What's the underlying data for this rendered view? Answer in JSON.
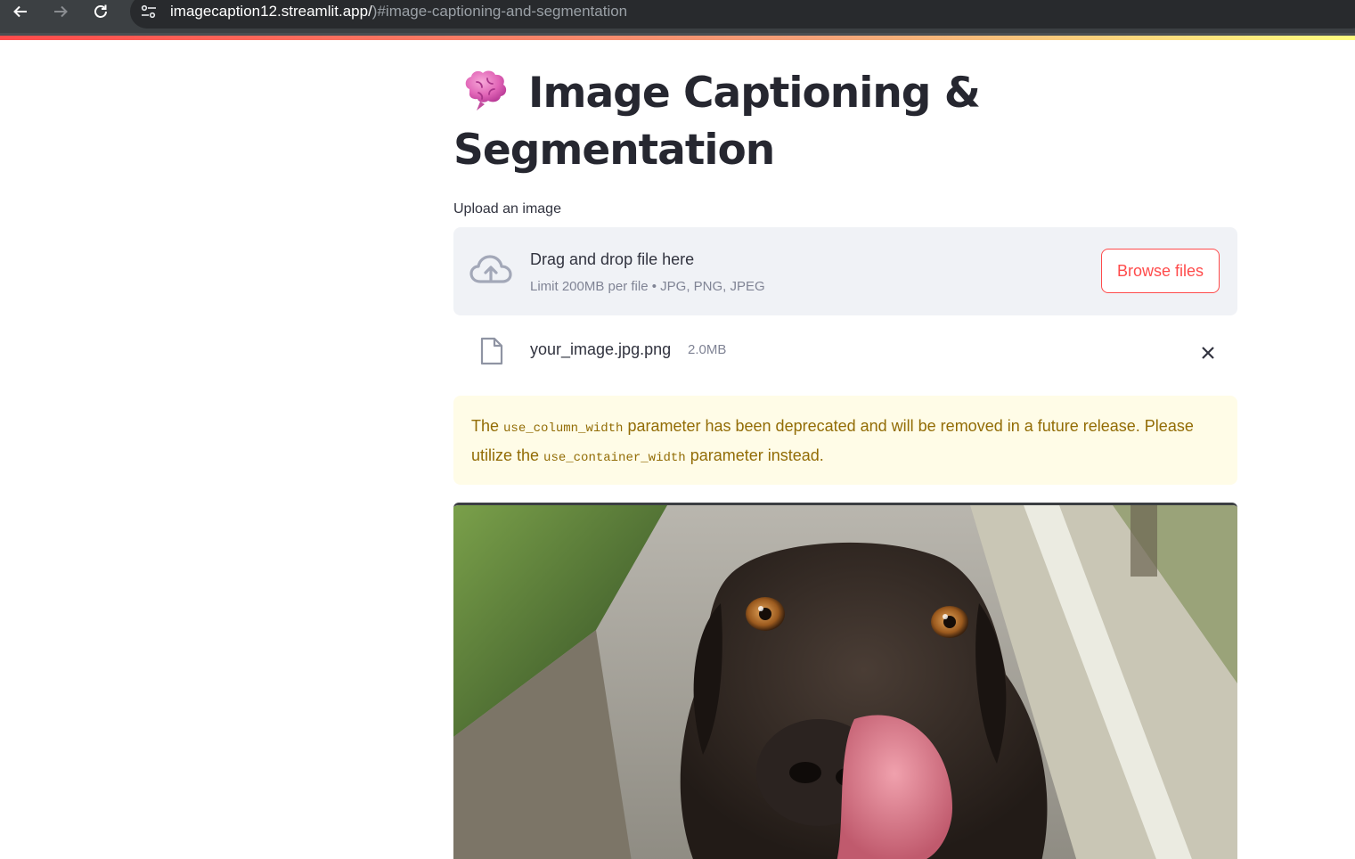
{
  "browser": {
    "url_host": "imagecaption12.streamlit.app/",
    "url_path": ")#image-captioning-and-segmentation"
  },
  "page": {
    "title_line1": "Image Captioning &",
    "title_line2": "Segmentation",
    "title_icon": "brain-icon"
  },
  "uploader": {
    "label": "Upload an image",
    "drop_text": "Drag and drop file here",
    "limit_text": "Limit 200MB per file • JPG, PNG, JPEG",
    "browse_label": "Browse files",
    "icon": "cloud-upload-icon"
  },
  "uploaded_file": {
    "name": "your_image.jpg.png",
    "size": "2.0MB",
    "icon": "file-icon",
    "remove_icon": "close-icon"
  },
  "warning": {
    "text_before": "The ",
    "code1": "use_column_width",
    "text_middle": " parameter has been deprecated and will be removed in a future release. Please utilize the ",
    "code2": "use_container_width",
    "text_after": " parameter instead."
  },
  "image": {
    "subject": "dog-photo"
  },
  "colors": {
    "accent": "#ff4b4b",
    "warning_bg": "#fffce7",
    "warning_text": "#926c05",
    "dropzone_bg": "#f0f2f6"
  }
}
